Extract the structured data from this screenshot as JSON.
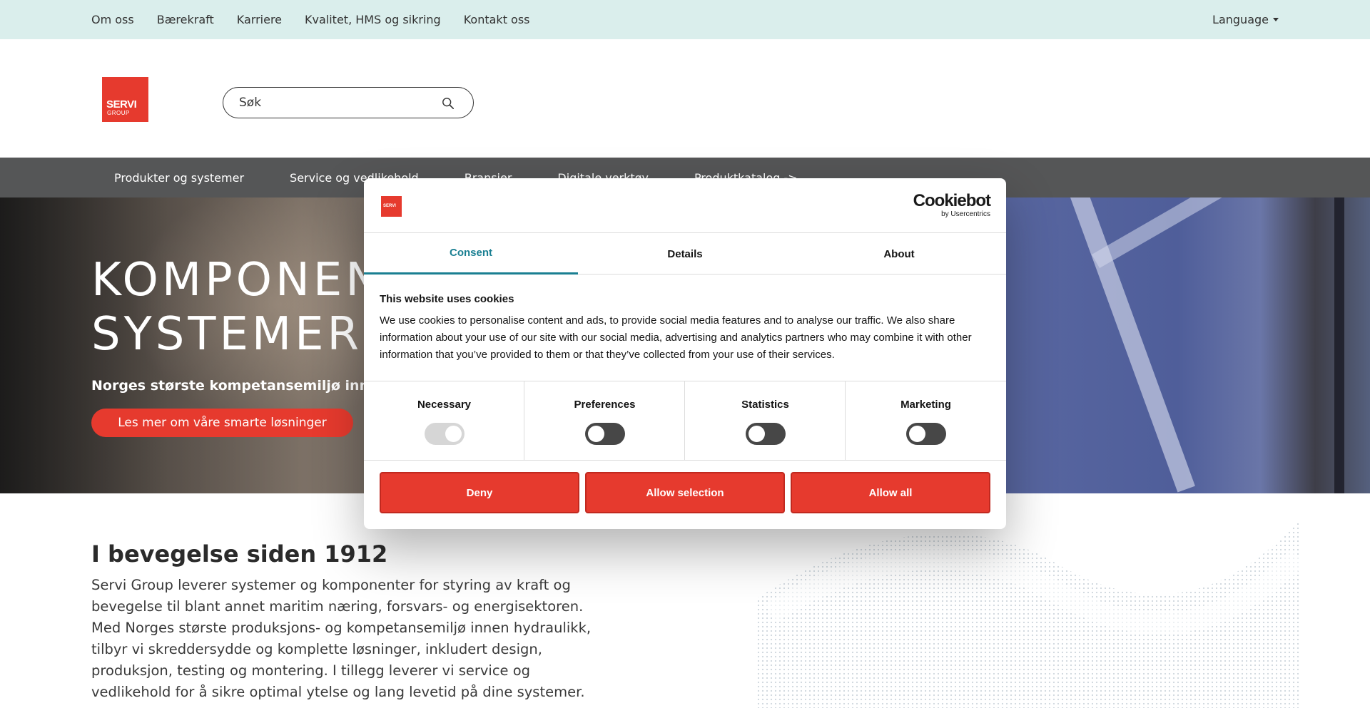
{
  "topbar": {
    "links": [
      "Om oss",
      "Bærekraft",
      "Karriere",
      "Kvalitet, HMS og sikring",
      "Kontakt oss"
    ],
    "language_label": "Language"
  },
  "header": {
    "logo": {
      "brand": "SERVI",
      "sub": "GROUP"
    },
    "search_placeholder": "Søk"
  },
  "mainnav": {
    "items": [
      "Produkter og systemer",
      "Service og vedlikehold",
      "Bransjer",
      "Digitale verktøy",
      "Produktkatalog ->"
    ]
  },
  "hero": {
    "title_line1": "KOMPONENTER OG",
    "title_line2": "SYSTEMER",
    "subtitle": "Norges største kompetansemiljø innen hydraulikk",
    "cta_label": "Les mer om våre smarte løsninger"
  },
  "content": {
    "heading": "I bevegelse siden 1912",
    "body": "Servi Group leverer systemer og komponenter for styring av kraft og bevegelse til blant annet maritim næring, forsvars- og energisektoren. Med Norges største produksjons- og kompetansemiljø innen hydraulikk, tilbyr vi skreddersydde og komplette løsninger, inkludert design, produksjon, testing og montering. I tillegg leverer vi service og vedlikehold for å sikre optimal ytelse og lang levetid på dine systemer."
  },
  "cookie_dialog": {
    "logo_text": "SERVI",
    "provider": "Cookiebot",
    "provider_sub": "by Usercentrics",
    "tabs": [
      "Consent",
      "Details",
      "About"
    ],
    "active_tab": "Consent",
    "title": "This website uses cookies",
    "body": "We use cookies to personalise content and ads, to provide social media features and to analyse our traffic. We also share information about your use of our site with our social media, advertising and analytics partners who may combine it with other information that you’ve provided to them or that they’ve collected from your use of their services.",
    "categories": [
      {
        "label": "Necessary",
        "enabled": true,
        "locked": true
      },
      {
        "label": "Preferences",
        "enabled": false,
        "locked": false
      },
      {
        "label": "Statistics",
        "enabled": false,
        "locked": false
      },
      {
        "label": "Marketing",
        "enabled": false,
        "locked": false
      }
    ],
    "buttons": {
      "deny": "Deny",
      "allow_selection": "Allow selection",
      "allow_all": "Allow all"
    }
  },
  "colors": {
    "brand_red": "#e63a2e",
    "topbar_bg": "#daeeec",
    "nav_bg": "#555657",
    "tab_accent": "#1a7f92"
  },
  "icons": {
    "search": "search-icon",
    "caret": "chevron-down-icon"
  }
}
